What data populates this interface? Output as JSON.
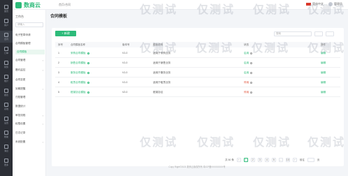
{
  "rail": {
    "items": [
      {
        "label": "首页",
        "icon": "home-icon"
      },
      {
        "label": "客户",
        "icon": "user-icon"
      },
      {
        "label": "合同",
        "icon": "doc-icon"
      },
      {
        "label": "订单",
        "icon": "list-icon"
      },
      {
        "label": "财务",
        "icon": "wallet-icon"
      },
      {
        "label": "统计",
        "icon": "chart-icon"
      },
      {
        "label": "报表",
        "icon": "table-icon"
      },
      {
        "label": "系统",
        "icon": "gear-icon"
      },
      {
        "label": "设置",
        "icon": "setting-icon"
      },
      {
        "label": "帮助",
        "icon": "help-icon"
      },
      {
        "label": "消息",
        "icon": "bell-icon"
      },
      {
        "label": "更多",
        "icon": "more-icon"
      }
    ]
  },
  "topbar": {
    "logo_text": "数商云",
    "breadcrumb": "首页/合同",
    "lang": "简体中文",
    "user": "管理员"
  },
  "sidebar": {
    "title": "工作台",
    "search_placeholder": "请输入",
    "items": [
      {
        "label": "电子签章申请",
        "arrow": ""
      },
      {
        "label": "合同模板管理",
        "arrow": ""
      },
      {
        "label": "合同模板",
        "arrow": ""
      },
      {
        "label": "合同管理",
        "arrow": "›"
      },
      {
        "label": "履约监控",
        "arrow": "›"
      },
      {
        "label": "合同变更",
        "arrow": ""
      },
      {
        "label": "到期提醒",
        "arrow": "›"
      },
      {
        "label": "归档管理",
        "arrow": ""
      },
      {
        "label": "数据统计",
        "arrow": ""
      },
      {
        "label": "审批流程",
        "arrow": "›"
      },
      {
        "label": "权限设置",
        "arrow": "›"
      },
      {
        "label": "日志记录",
        "arrow": ""
      },
      {
        "label": "系统配置",
        "arrow": "›"
      }
    ]
  },
  "main": {
    "page_title": "合同模板",
    "add_button": "+ 新建",
    "search_placeholder": "搜索",
    "columns": [
      "序号",
      "合同模板名称",
      "版本号",
      "模板说明",
      "",
      "状态",
      "操作"
    ],
    "rows": [
      {
        "no": "1",
        "name": "采购合同模板",
        "version": "V1.0",
        "desc": "适用于采购业务",
        "status": "启用",
        "status_type": "on",
        "op": "编辑"
      },
      {
        "no": "2",
        "name": "销售合同模板",
        "version": "V1.0",
        "desc": "适用于销售业务",
        "status": "启用",
        "status_type": "on",
        "op": "编辑"
      },
      {
        "no": "3",
        "name": "服务合同模板",
        "version": "V1.0",
        "desc": "适用于服务业务",
        "status": "启用",
        "status_type": "on",
        "op": "编辑"
      },
      {
        "no": "4",
        "name": "租赁合同模板",
        "version": "V1.0",
        "desc": "适用于租赁业务",
        "status": "停用",
        "status_type": "off",
        "op": "编辑"
      },
      {
        "no": "5",
        "name": "框架协议模板",
        "version": "V2.0",
        "desc": "框架协议",
        "status": "停用",
        "status_type": "off",
        "op": "编辑"
      }
    ],
    "pager": {
      "total": "共 50 条",
      "pages": [
        "1",
        "2",
        "3",
        "4",
        "5",
        "…",
        "10"
      ],
      "active_page": "1",
      "goto": "前往",
      "page_unit": "页"
    }
  },
  "footer": "Copy Right©2021 数商云版权所有 粤ICP备XXXXXXXX号",
  "watermarks": [
    "仅测试",
    "仅测试",
    "仅测试",
    "仅测试",
    "仅测试",
    "仅测试",
    "仅测试",
    "仅测试",
    "仅测试",
    "仅测试",
    "仅测试",
    "仅测试"
  ],
  "colors": {
    "accent": "#2dbb7a",
    "danger": "#e1533b",
    "rail": "#2c2f36"
  }
}
